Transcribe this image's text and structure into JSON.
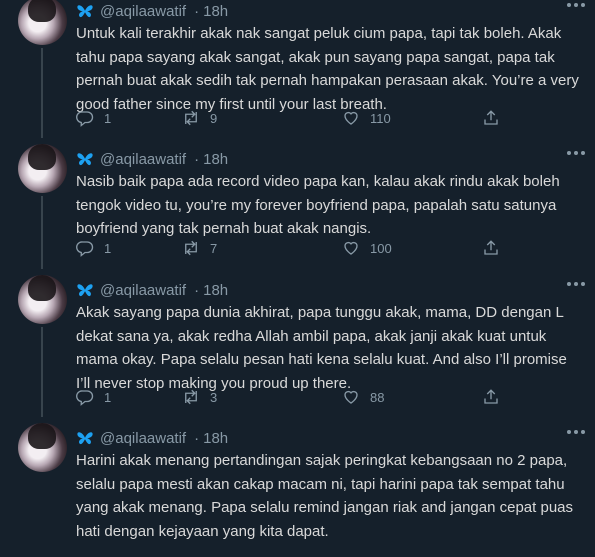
{
  "tweets": [
    {
      "handle": "@aqilaawatif",
      "separator": "·",
      "time": "18h",
      "text": "Untuk kali terakhir akak nak sangat peluk cium papa, tapi tak boleh. Akak tahu papa sayang akak sangat, akak pun sayang papa sangat, papa tak pernah buat akak sedih tak pernah hampakan perasaan akak. You’re a very good father since my first until your last breath.",
      "replies": "1",
      "retweets": "9",
      "likes": "110"
    },
    {
      "handle": "@aqilaawatif",
      "separator": "·",
      "time": "18h",
      "text": "Nasib baik papa ada record video papa kan, kalau akak rindu akak boleh tengok video tu, you’re my forever boyfriend papa, papalah satu satunya boyfriend yang tak pernah buat akak nangis.",
      "replies": "1",
      "retweets": "7",
      "likes": "100"
    },
    {
      "handle": "@aqilaawatif",
      "separator": "·",
      "time": "18h",
      "text": "Akak sayang papa dunia akhirat, papa tunggu akak, mama, DD dengan L dekat sana ya, akak redha Allah ambil papa, akak janji akak kuat untuk mama okay. Papa selalu pesan hati kena selalu kuat. And also I’ll promise I’ll never stop making you proud up there.",
      "replies": "1",
      "retweets": "3",
      "likes": "88"
    },
    {
      "handle": "@aqilaawatif",
      "separator": "·",
      "time": "18h",
      "text": "Harini akak menang pertandingan sajak peringkat kebangsaan no 2 papa, selalu papa mesti akan cakap macam ni, tapi harini papa tak sempat tahu yang akak menang. Papa selalu remind jangan riak and jangan cepat puas hati dengan kejayaan yang kita dapat."
    }
  ],
  "icons": {
    "badge": "butterfly-icon",
    "more": "more-icon",
    "reply": "reply-icon",
    "retweet": "retweet-icon",
    "like": "heart-icon",
    "share": "share-icon"
  },
  "colors": {
    "background": "#15202b",
    "text": "#d9d9d9",
    "muted": "#8899a6",
    "butterfly": "#1da1f2"
  }
}
